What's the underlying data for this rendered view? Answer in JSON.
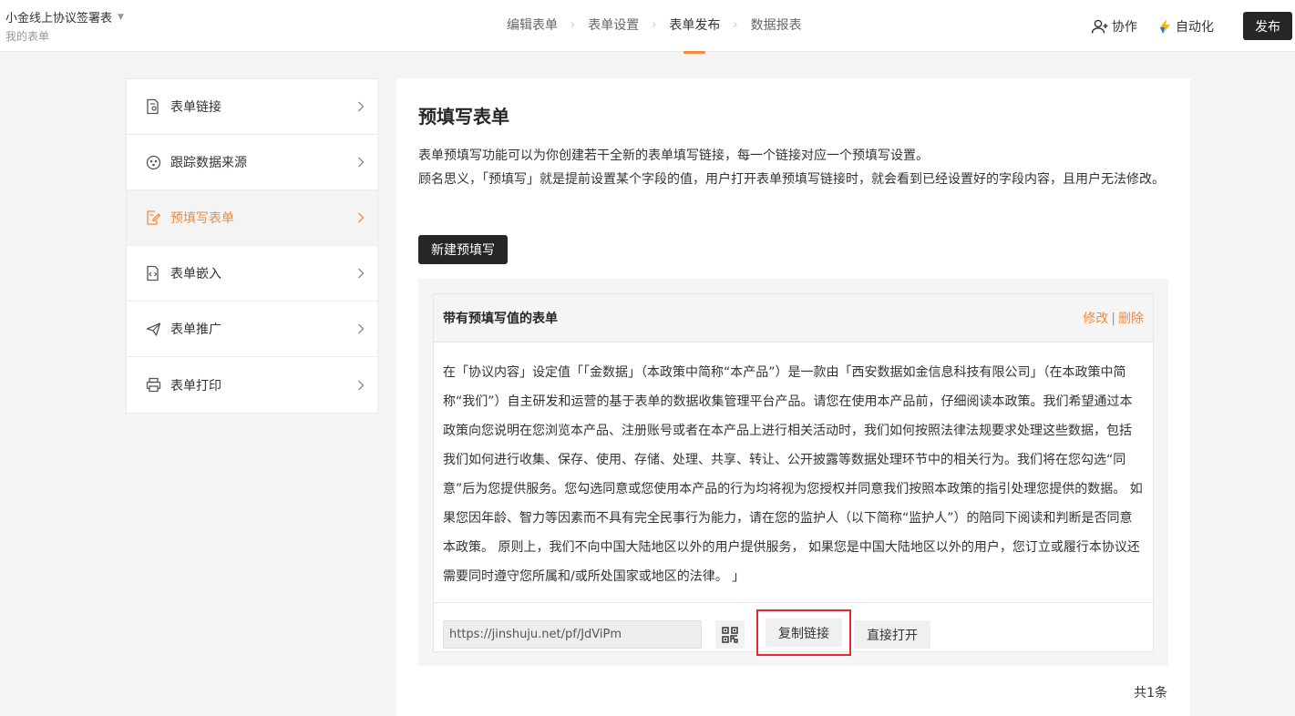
{
  "app": {
    "title": "小金线上协议签署表",
    "subtitle": "我的表单"
  },
  "steps": [
    {
      "label": "编辑表单"
    },
    {
      "label": "表单设置"
    },
    {
      "label": "表单发布"
    },
    {
      "label": "数据报表"
    }
  ],
  "topbar": {
    "collab_label": "协作",
    "auto_label": "自动化",
    "publish_label": "发布"
  },
  "sidebar": {
    "items": [
      {
        "label": "表单链接",
        "icon": "form-link-icon"
      },
      {
        "label": "跟踪数据来源",
        "icon": "track-source-icon"
      },
      {
        "label": "预填写表单",
        "icon": "prefill-icon"
      },
      {
        "label": "表单嵌入",
        "icon": "embed-icon"
      },
      {
        "label": "表单推广",
        "icon": "promote-icon"
      },
      {
        "label": "表单打印",
        "icon": "print-icon"
      }
    ],
    "active_index": 2
  },
  "main": {
    "title": "预填写表单",
    "desc_line1": "表单预填写功能可以为你创建若干全新的表单填写链接，每一个链接对应一个预填写设置。",
    "desc_line2": "顾名思义，「预填写」就是提前设置某个字段的值，用户打开表单预填写链接时，就会看到已经设置好的字段内容，且用户无法修改。",
    "new_button": "新建预填写",
    "card": {
      "title": "带有预填写值的表单",
      "edit_label": "修改",
      "divider": "|",
      "delete_label": "删除",
      "body": "在「协议内容」设定值「「金数据」（本政策中简称“本产品”）是一款由「西安数据如金信息科技有限公司」（在本政策中简称“我们”）自主研发和运营的基于表单的数据收集管理平台产品。请您在使用本产品前，仔细阅读本政策。我们希望通过本政策向您说明在您浏览本产品、注册账号或者在本产品上进行相关活动时，我们如何按照法律法规要求处理这些数据，包括我们如何进行收集、保存、使用、存储、处理、共享、转让、公开披露等数据处理环节中的相关行为。我们将在您勾选“同意”后为您提供服务。您勾选同意或您使用本产品的行为均将视为您授权并同意我们按照本政策的指引处理您提供的数据。 如果您因年龄、智力等因素而不具有完全民事行为能力，请在您的监护人（以下简称“监护人”）的陪同下阅读和判断是否同意本政策。 原则上，我们不向中国大陆地区以外的用户提供服务， 如果您是中国大陆地区以外的用户，您订立或履行本协议还需要同时遵守您所属和/或所处国家或地区的法律。 」",
      "url": "https://jinshuju.net/pf/JdViPm",
      "copy_label": "复制链接",
      "open_label": "直接打开"
    },
    "total": "共1条"
  },
  "colors": {
    "accent": "#f58a3b",
    "dark": "#262626",
    "highlight_border": "#e5292e"
  }
}
